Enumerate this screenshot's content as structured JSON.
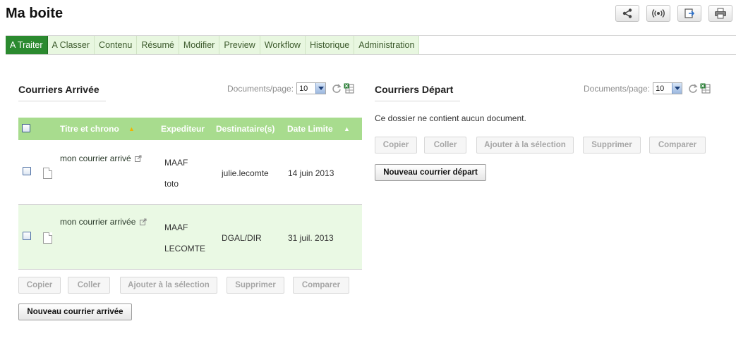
{
  "page_title": "Ma boite",
  "header_actions": [
    {
      "name": "share",
      "icon": "share-icon"
    },
    {
      "name": "subscribe",
      "icon": "broadcast-icon"
    },
    {
      "name": "export",
      "icon": "export-icon"
    },
    {
      "name": "print",
      "icon": "print-icon"
    }
  ],
  "tabs": [
    {
      "label": "A Traiter",
      "active": true
    },
    {
      "label": "A Classer"
    },
    {
      "label": "Contenu"
    },
    {
      "label": "Résumé"
    },
    {
      "label": "Modifier"
    },
    {
      "label": "Preview"
    },
    {
      "label": "Workflow"
    },
    {
      "label": "Historique"
    },
    {
      "label": "Administration"
    }
  ],
  "arrivee": {
    "title": "Courriers Arrivée",
    "docs_per_page_label": "Documents/page:",
    "docs_per_page_value": "10",
    "columns": {
      "title": "Titre et chrono",
      "sender": "Expediteur",
      "recipient": "Destinataire(s)",
      "deadline": "Date Limite",
      "sort_up": "▲"
    },
    "rows": [
      {
        "title": "mon courrier arrivé",
        "sender_line1": "MAAF",
        "sender_line2": "toto",
        "recipient": "julie.lecomte",
        "deadline": "14 juin 2013"
      },
      {
        "title": "mon courrier arrivée",
        "sender_line1": "MAAF",
        "sender_line2": "LECOMTE",
        "recipient": "DGAL/DIR",
        "deadline": "31 juil. 2013"
      }
    ],
    "buttons": [
      "Copier",
      "Coller",
      "Ajouter à la sélection",
      "Supprimer",
      "Comparer"
    ],
    "new_button": "Nouveau courrier arrivée"
  },
  "depart": {
    "title": "Courriers Départ",
    "docs_per_page_label": "Documents/page:",
    "docs_per_page_value": "10",
    "empty_message": "Ce dossier ne contient aucun document.",
    "buttons": [
      "Copier",
      "Coller",
      "Ajouter à la sélection",
      "Supprimer",
      "Comparer"
    ],
    "new_button": "Nouveau courrier départ"
  },
  "colors": {
    "accent_green": "#2b8a2f",
    "header_green": "#a8dc8e",
    "row_alt": "#eaf9e4",
    "tab_bg": "#e8f7e0",
    "sort_arrow": "#f0b400"
  }
}
